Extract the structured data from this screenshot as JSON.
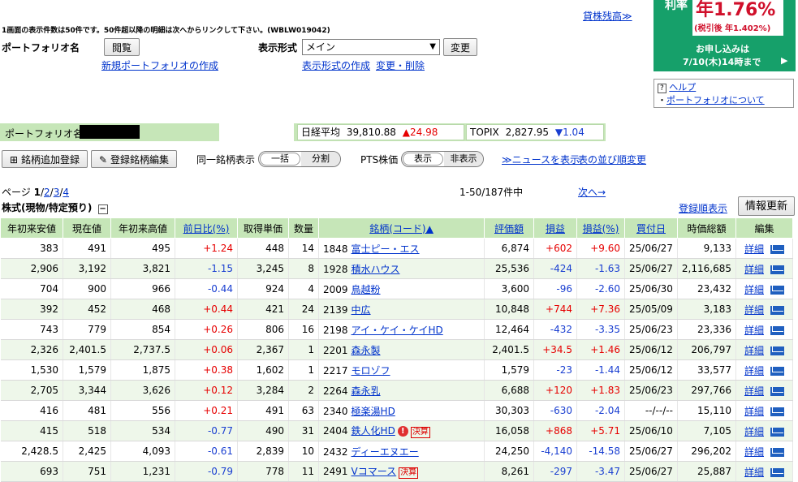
{
  "notice": "1画面の表示件数は50件です。50件超以降の明細は次へからリンクして下さい。(WBLW019042)",
  "links_top": {
    "lending_balance": "貸株残高≫"
  },
  "portfolio": {
    "label": "ポートフォリオ名",
    "browse_button": "閲覧",
    "create_link": "新規ポートフォリオの作成",
    "display_format_label": "表示形式",
    "display_format_value": "メイン",
    "change_button": "変更",
    "format_create_link": "表示形式の作成",
    "format_edit_link": "変更・削除"
  },
  "banner": {
    "rate_label": "利率",
    "rate_value": "年1.76%",
    "rate_after_tax": "(税引後 年1.402%)",
    "apply_line1": "お申し込みは",
    "apply_line2": "7/10(木)14時まで"
  },
  "help": {
    "help_link": "ヘルプ",
    "about_link": "ポートフォリオについて"
  },
  "info_bar": {
    "portfolio_name_label": "ポートフォリオ名 /",
    "nikkei_label": "日経平均",
    "nikkei_value": "39,810.88",
    "nikkei_change": "▲24.98",
    "topix_label": "TOPIX",
    "topix_value": "2,827.95",
    "topix_change": "▼1.04"
  },
  "toolbar": {
    "add_button": "銘柄追加登録",
    "edit_button": "登録銘柄編集",
    "same_stock_label": "同一銘柄表示",
    "same_stock_options": [
      "一括",
      "分割"
    ],
    "pts_label": "PTS株価",
    "pts_options": [
      "表示",
      "非表示"
    ],
    "news_link": "≫ニュースを表示",
    "sort_link": "表の並び順変更"
  },
  "paging": {
    "page_label": "ページ",
    "current": "1",
    "pages": [
      "2",
      "3",
      "4"
    ],
    "count_text": "1-50/187件中",
    "next_link": "次へ→"
  },
  "section": {
    "title": "株式(現物/特定預り)",
    "collapse": "−",
    "order_link": "登録順表示",
    "refresh_button": "情報更新"
  },
  "table": {
    "headers": [
      "年初来安値",
      "現在値",
      "年初来高値",
      "前日比(%)",
      "取得単価",
      "数量",
      "銘柄(コード)▲",
      "評価額",
      "損益",
      "損益(%)",
      "買付日",
      "時価総額",
      "編集"
    ],
    "rows": [
      {
        "low": "383",
        "price": "491",
        "high": "495",
        "chg": "+1.24",
        "cost": "448",
        "qty": "14",
        "code": "1848",
        "name": "富士ピー・エス",
        "badge": "",
        "value": "6,874",
        "pl": "+602",
        "plp": "+9.60",
        "date": "25/06/27",
        "mcap": "9,133"
      },
      {
        "low": "2,906",
        "price": "3,192",
        "high": "3,821",
        "chg": "-1.15",
        "cost": "3,245",
        "qty": "8",
        "code": "1928",
        "name": "積水ハウス",
        "badge": "",
        "value": "25,536",
        "pl": "-424",
        "plp": "-1.63",
        "date": "25/06/27",
        "mcap": "2,116,685"
      },
      {
        "low": "704",
        "price": "900",
        "high": "966",
        "chg": "-0.44",
        "cost": "924",
        "qty": "4",
        "code": "2009",
        "name": "鳥越粉",
        "badge": "",
        "value": "3,600",
        "pl": "-96",
        "plp": "-2.60",
        "date": "25/06/30",
        "mcap": "23,432"
      },
      {
        "low": "392",
        "price": "452",
        "high": "468",
        "chg": "+0.44",
        "cost": "421",
        "qty": "24",
        "code": "2139",
        "name": "中広",
        "badge": "",
        "value": "10,848",
        "pl": "+744",
        "plp": "+7.36",
        "date": "25/05/09",
        "mcap": "3,183"
      },
      {
        "low": "743",
        "price": "779",
        "high": "854",
        "chg": "+0.26",
        "cost": "806",
        "qty": "16",
        "code": "2198",
        "name": "アイ・ケイ・ケイHD",
        "badge": "",
        "value": "12,464",
        "pl": "-432",
        "plp": "-3.35",
        "date": "25/06/23",
        "mcap": "23,336"
      },
      {
        "low": "2,326",
        "price": "2,401.5",
        "high": "2,737.5",
        "chg": "+0.06",
        "cost": "2,367",
        "qty": "1",
        "code": "2201",
        "name": "森永製",
        "badge": "",
        "value": "2,401.5",
        "pl": "+34.5",
        "plp": "+1.46",
        "date": "25/06/12",
        "mcap": "206,797"
      },
      {
        "low": "1,530",
        "price": "1,579",
        "high": "1,875",
        "chg": "+0.38",
        "cost": "1,602",
        "qty": "1",
        "code": "2217",
        "name": "モロゾフ",
        "badge": "",
        "value": "1,579",
        "pl": "-23",
        "plp": "-1.44",
        "date": "25/06/12",
        "mcap": "33,577"
      },
      {
        "low": "2,705",
        "price": "3,344",
        "high": "3,626",
        "chg": "+0.12",
        "cost": "3,284",
        "qty": "2",
        "code": "2264",
        "name": "森永乳",
        "badge": "",
        "value": "6,688",
        "pl": "+120",
        "plp": "+1.83",
        "date": "25/06/23",
        "mcap": "297,766"
      },
      {
        "low": "416",
        "price": "481",
        "high": "556",
        "chg": "+0.21",
        "cost": "491",
        "qty": "63",
        "code": "2340",
        "name": "極楽湯HD",
        "badge": "",
        "value": "30,303",
        "pl": "-630",
        "plp": "-2.04",
        "date": "--/--/--",
        "mcap": "15,110"
      },
      {
        "low": "415",
        "price": "518",
        "high": "534",
        "chg": "-0.77",
        "cost": "490",
        "qty": "31",
        "code": "2404",
        "name": "鉄人化HD",
        "badge": "!決算",
        "value": "16,058",
        "pl": "+868",
        "plp": "+5.71",
        "date": "25/06/10",
        "mcap": "7,105"
      },
      {
        "low": "2,428.5",
        "price": "2,425",
        "high": "4,093",
        "chg": "-0.61",
        "cost": "2,839",
        "qty": "10",
        "code": "2432",
        "name": "ディーエヌエー",
        "badge": "",
        "value": "24,250",
        "pl": "-4,140",
        "plp": "-14.58",
        "date": "25/06/27",
        "mcap": "296,202"
      },
      {
        "low": "693",
        "price": "751",
        "high": "1,231",
        "chg": "-0.79",
        "cost": "778",
        "qty": "11",
        "code": "2491",
        "name": "Vコマース",
        "badge": "決算",
        "value": "8,261",
        "pl": "-297",
        "plp": "-3.47",
        "date": "25/06/27",
        "mcap": "25,887"
      }
    ],
    "detail_label": "詳細"
  },
  "colors": {
    "green_bar": "#c6e6b8",
    "up": "#e60000",
    "down": "#1a3fd1",
    "banner": "#16a06a"
  }
}
